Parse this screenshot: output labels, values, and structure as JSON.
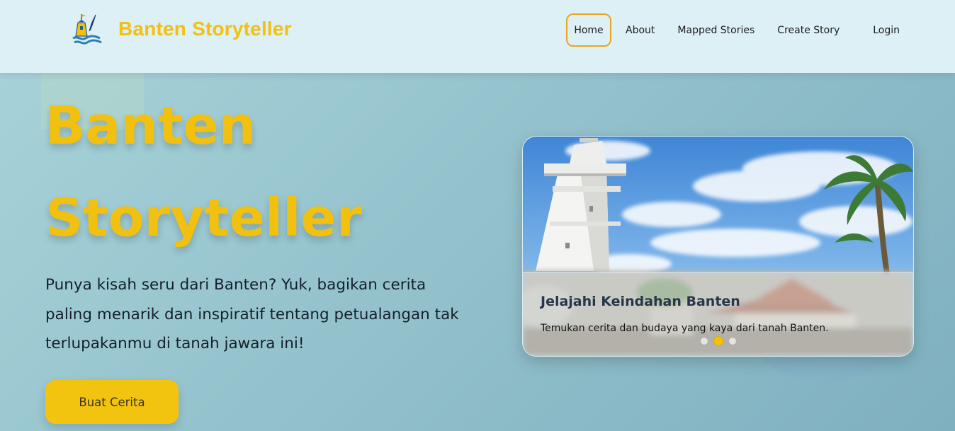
{
  "header": {
    "brand_name": "Banten Storyteller",
    "nav": [
      {
        "label": "Home",
        "active": true
      },
      {
        "label": "About"
      },
      {
        "label": "Mapped Stories"
      },
      {
        "label": "Create Story"
      },
      {
        "label": "Login"
      }
    ]
  },
  "hero": {
    "title_line1": "Banten",
    "title_line2": "Storyteller",
    "description": "Punya kisah seru dari Banten? Yuk, bagikan cerita paling menarik dan inspiratif tentang petualangan tak terlupakanmu di tanah jawara ini!",
    "cta_label": "Buat Cerita"
  },
  "carousel": {
    "slide_title": "Jelajahi Keindahan Banten",
    "slide_text": "Temukan cerita dan budaya yang kaya dari tanah Banten.",
    "slide_count": 3,
    "active_index": 1
  },
  "colors": {
    "brand_yellow": "#f2c00f",
    "nav_active_border": "#e8a51e",
    "header_bg": "#ddf0f6",
    "hero_bg": "#95c3cd"
  },
  "icons": {
    "logo": "lighthouse-feather-logo-icon"
  }
}
